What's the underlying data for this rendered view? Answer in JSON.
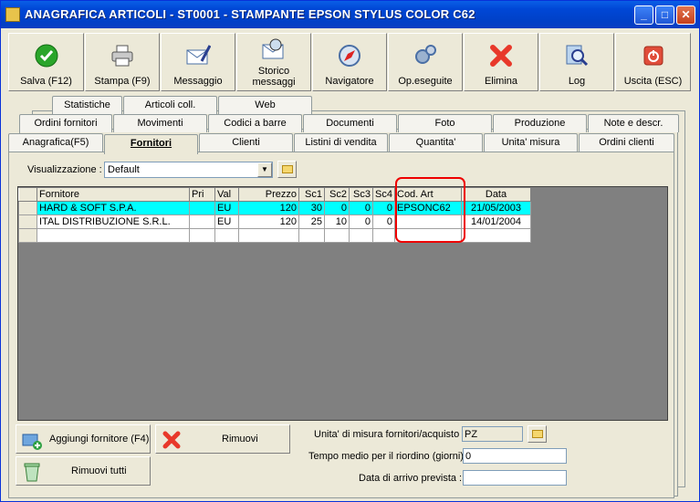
{
  "window": {
    "title": "ANAGRAFICA ARTICOLI - ST0001 - STAMPANTE EPSON STYLUS COLOR C62"
  },
  "toolbar": [
    {
      "label": "Salva (F12)",
      "icon": "check-icon"
    },
    {
      "label": "Stampa (F9)",
      "icon": "printer-icon"
    },
    {
      "label": "Messaggio",
      "icon": "envelope-pen-icon"
    },
    {
      "label": "Storico messaggi",
      "icon": "envelope-search-icon"
    },
    {
      "label": "Navigatore",
      "icon": "compass-icon"
    },
    {
      "label": "Op.eseguite",
      "icon": "gears-icon"
    },
    {
      "label": "Elimina",
      "icon": "red-x-icon"
    },
    {
      "label": "Log",
      "icon": "magnifier-icon"
    },
    {
      "label": "Uscita (ESC)",
      "icon": "exit-icon"
    }
  ],
  "tabs_row3": [
    "Statistiche",
    "Articoli coll.",
    "Web"
  ],
  "tabs_row2": [
    "Ordini fornitori",
    "Movimenti",
    "Codici a barre",
    "Documenti",
    "Foto",
    "Produzione",
    "Note e descr."
  ],
  "tabs_row1": [
    "Anagrafica(F5)",
    "Fornitori",
    "Clienti",
    "Listini di vendita",
    "Quantita'",
    "Unita' misura",
    "Ordini clienti"
  ],
  "view": {
    "label": "Visualizzazione :",
    "value": "Default"
  },
  "grid": {
    "headers": [
      "Fornitore",
      "Pri",
      "Val",
      "Prezzo",
      "Sc1",
      "Sc2",
      "Sc3",
      "Sc4",
      "Cod. Art",
      "Data"
    ],
    "rows": [
      [
        "HARD & SOFT S.P.A.",
        "",
        "EU",
        "120",
        "30",
        "0",
        "0",
        "0",
        "EPSONC62",
        "21/05/2003"
      ],
      [
        "ITAL DISTRIBUZIONE S.R.L.",
        "",
        "EU",
        "120",
        "25",
        "10",
        "0",
        "0",
        "",
        "14/01/2004"
      ]
    ]
  },
  "buttons": {
    "add": "Aggiungi fornitore (F4)",
    "remove": "Rimuovi",
    "remove_all": "Rimuovi tutti"
  },
  "fields": {
    "unit_label": "Unita' di misura fornitori/acquisto :",
    "unit_value": "PZ",
    "reorder_label": "Tempo medio per il riordino (giorni) :",
    "reorder_value": "0",
    "arrival_label": "Data di arrivo prevista :",
    "arrival_value": ""
  }
}
